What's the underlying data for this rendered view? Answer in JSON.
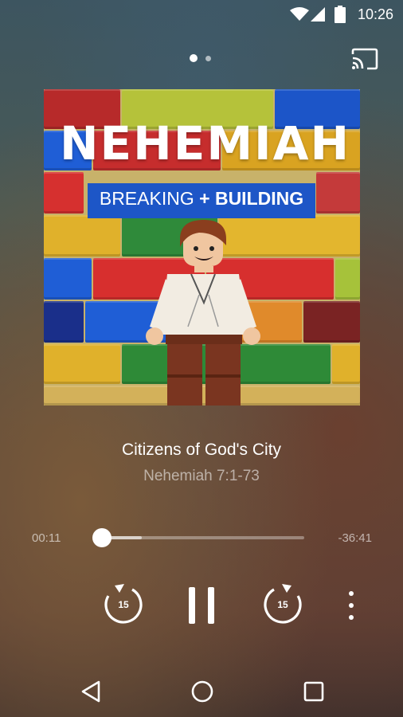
{
  "status_bar": {
    "time": "10:26",
    "icons": [
      "wifi-icon",
      "signal-icon",
      "battery-icon"
    ]
  },
  "header": {
    "pager": {
      "total": 2,
      "active": 1
    },
    "cast_icon": "cast-icon"
  },
  "artwork": {
    "title": "NEHEMIAH",
    "subtitle_left": "BREAKING",
    "subtitle_plus": "+",
    "subtitle_right": "BUILDING"
  },
  "episode": {
    "title": "Citizens of God's City",
    "subtitle": "Nehemiah 7:1-73"
  },
  "player": {
    "elapsed": "00:11",
    "remaining": "-36:41",
    "progress": 0.005,
    "buffered": 0.2,
    "rewind_label": "15",
    "forward_label": "15"
  },
  "nav": {
    "icons": [
      "back-icon",
      "home-icon",
      "recents-icon"
    ]
  }
}
